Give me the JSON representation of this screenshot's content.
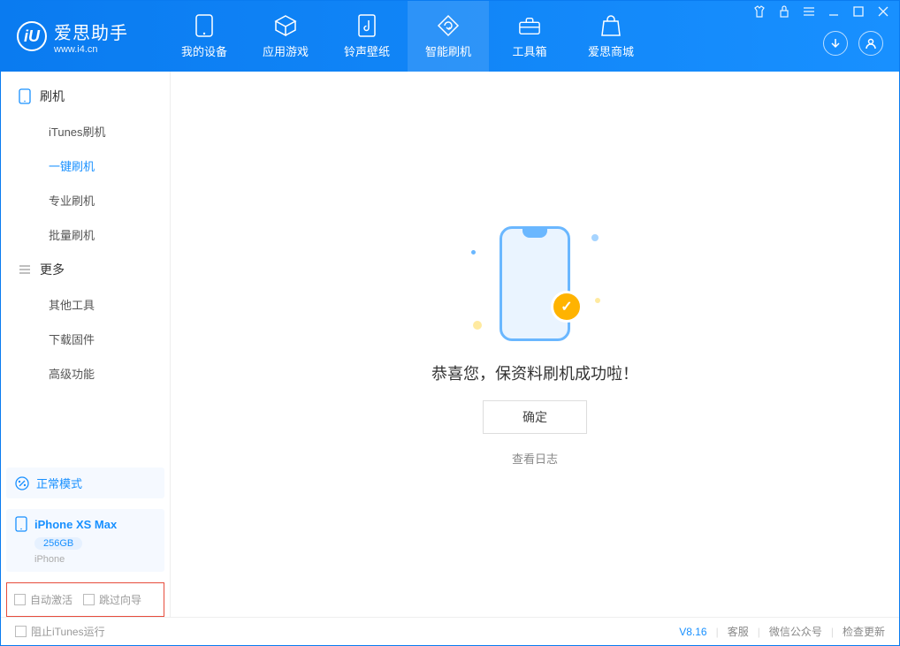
{
  "app": {
    "name": "爱思助手",
    "url": "www.i4.cn"
  },
  "topnav": [
    {
      "label": "我的设备",
      "icon": "device-icon"
    },
    {
      "label": "应用游戏",
      "icon": "cube-icon"
    },
    {
      "label": "铃声壁纸",
      "icon": "music-icon"
    },
    {
      "label": "智能刷机",
      "icon": "refresh-icon",
      "active": true
    },
    {
      "label": "工具箱",
      "icon": "toolbox-icon"
    },
    {
      "label": "爱思商城",
      "icon": "bag-icon"
    }
  ],
  "sidebar": {
    "groups": [
      {
        "title": "刷机",
        "items": [
          {
            "label": "iTunes刷机"
          },
          {
            "label": "一键刷机",
            "active": true
          },
          {
            "label": "专业刷机"
          },
          {
            "label": "批量刷机"
          }
        ]
      },
      {
        "title": "更多",
        "items": [
          {
            "label": "其他工具"
          },
          {
            "label": "下载固件"
          },
          {
            "label": "高级功能"
          }
        ]
      }
    ],
    "mode": {
      "label": "正常模式"
    },
    "device": {
      "name": "iPhone XS Max",
      "storage": "256GB",
      "type": "iPhone"
    },
    "checkboxes": {
      "auto_activate": "自动激活",
      "skip_guide": "跳过向导"
    }
  },
  "main": {
    "success_title": "恭喜您，保资料刷机成功啦！",
    "confirm": "确定",
    "view_log": "查看日志"
  },
  "statusbar": {
    "block_itunes": "阻止iTunes运行",
    "version": "V8.16",
    "links": [
      "客服",
      "微信公众号",
      "检查更新"
    ]
  }
}
